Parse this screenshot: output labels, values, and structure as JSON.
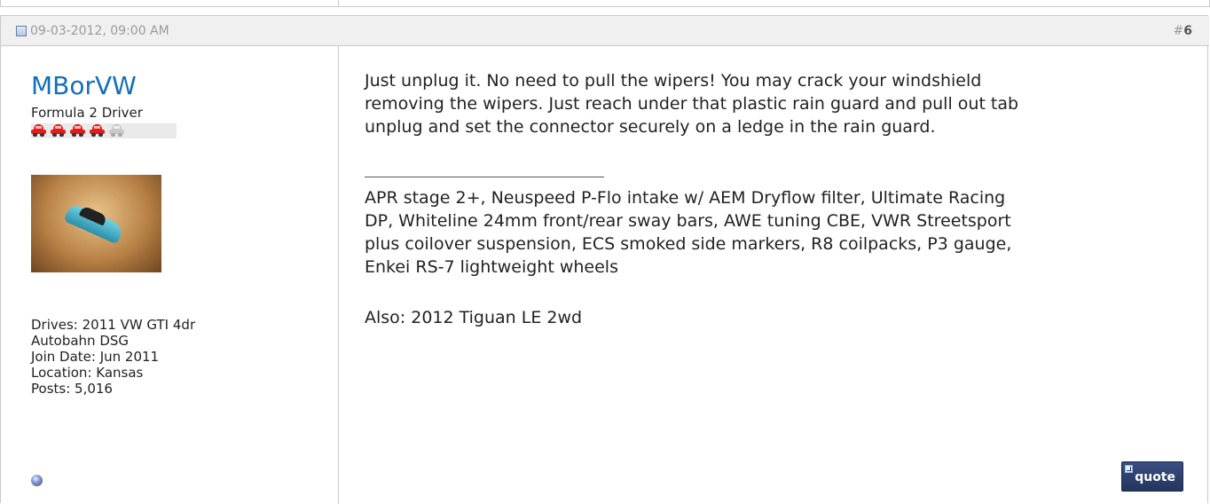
{
  "post": {
    "date": "09-03-2012, 09:00 AM",
    "number_prefix": "#",
    "number": "6",
    "user": {
      "username": "MBorVW",
      "title": "Formula 2 Driver",
      "reputation": {
        "filled": 4,
        "total": 5,
        "color_filled": "#e31b1b",
        "color_empty": "#c8c8c8"
      },
      "drives_line1": "Drives: 2011 VW GTI 4dr",
      "drives_line2": "Autobahn DSG",
      "join_date": "Join Date: Jun 2011",
      "location": "Location: Kansas",
      "posts": "Posts: 5,016",
      "status_icon": "offline-status-icon"
    },
    "message_line1": "Just unplug it. No need to pull the wipers! You may crack your windshield",
    "message_line2": "removing the wipers. Just reach under that plastic rain guard and pull out tab",
    "message_line3": "unplug and set the connector securely on a ledge in the rain guard.",
    "signature": {
      "line1": "APR stage 2+, Neuspeed P-Flo intake w/ AEM Dryflow filter, Ultimate Racing",
      "line2": "DP, Whiteline 24mm front/rear sway bars, AWE tuning CBE, VWR Streetsport",
      "line3": "plus coilover suspension, ECS smoked side markers, R8 coilpacks, P3 gauge,",
      "line4": "Enkei RS-7 lightweight wheels",
      "also": "Also: 2012 Tiguan LE 2wd"
    },
    "quote_label": "quote"
  },
  "colors": {
    "username": "#1470b8",
    "header_bg": "#f0f0f0",
    "border": "#c9c9c9",
    "quote_button": "#2e4270"
  }
}
